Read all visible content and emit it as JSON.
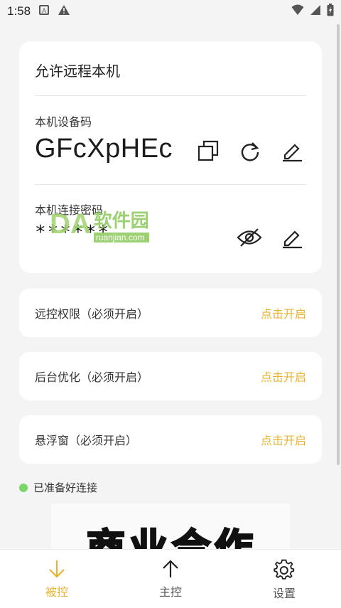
{
  "status_bar": {
    "time": "1:58",
    "left_icons": [
      "a-box-icon",
      "warning-icon"
    ],
    "right_icons": [
      "wifi-icon",
      "signal-icon",
      "battery-icon"
    ]
  },
  "remote_card": {
    "title": "允许远程本机",
    "device_code_label": "本机设备码",
    "device_code": "GFcXpHEc",
    "password_label": "本机连接密码",
    "password": "******"
  },
  "watermark": {
    "cn": "软件园",
    "en": "ruanjian.com"
  },
  "permissions": [
    {
      "label": "远控权限（必须开启）",
      "action": "点击开启"
    },
    {
      "label": "后台优化（必须开启）",
      "action": "点击开启"
    },
    {
      "label": "悬浮窗（必须开启）",
      "action": "点击开启"
    }
  ],
  "ready_status": "已准备好连接",
  "banner_text": "商业合作",
  "bottom_nav": [
    {
      "label": "被控",
      "icon": "arrow-down-icon",
      "active": true
    },
    {
      "label": "主控",
      "icon": "arrow-up-icon",
      "active": false
    },
    {
      "label": "设置",
      "icon": "gear-icon",
      "active": false
    }
  ],
  "colors": {
    "accent": "#e8b430",
    "ready": "#7bd66a",
    "background": "#f4f4f4"
  }
}
